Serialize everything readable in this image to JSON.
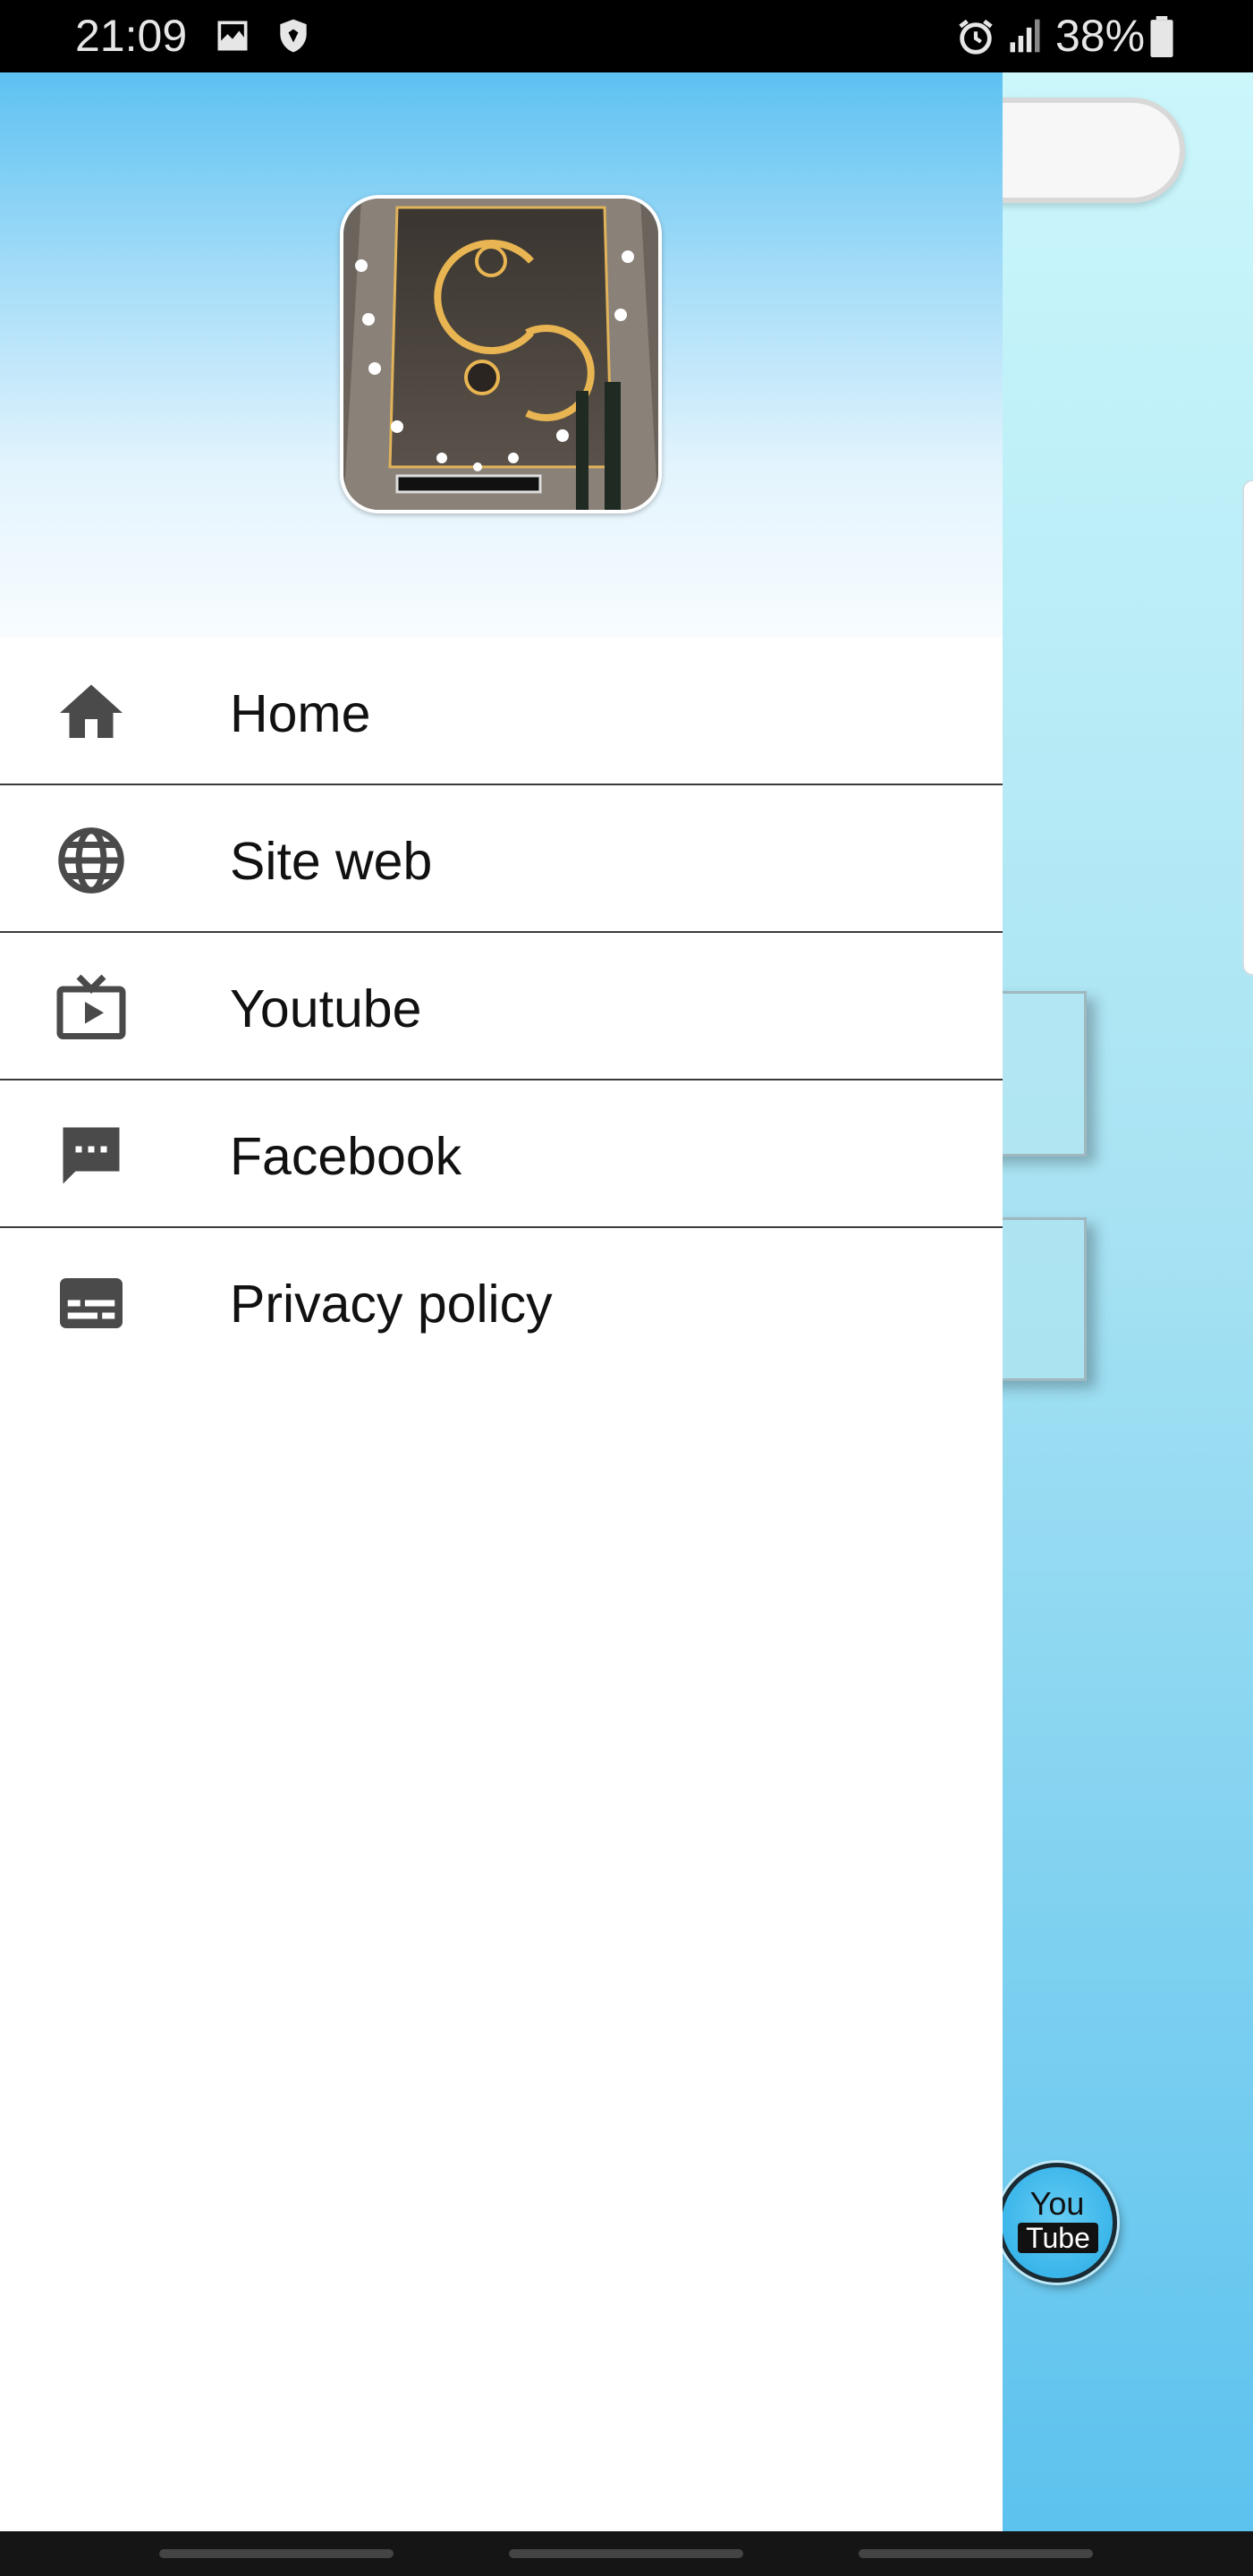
{
  "status_bar": {
    "time": "21:09",
    "battery_text": "38%",
    "icons": [
      "image-icon",
      "shield-icon",
      "alarm-icon",
      "signal-icon",
      "battery-icon"
    ]
  },
  "drawer": {
    "header": {
      "logo": "ceiling-design-image"
    },
    "menu": [
      {
        "label": "Home",
        "icon": "home-icon"
      },
      {
        "label": "Site web",
        "icon": "globe-icon"
      },
      {
        "label": "Youtube",
        "icon": "tv-play-icon"
      },
      {
        "label": "Facebook",
        "icon": "chat-bubble-icon"
      },
      {
        "label": "Privacy policy",
        "icon": "subtitles-icon"
      }
    ]
  },
  "background_app": {
    "youtube_badge": {
      "top": "You",
      "bottom": "Tube"
    }
  },
  "colors": {
    "drawer_header_top": "#5dc1f1",
    "background_top": "#cbf7fb",
    "background_bottom": "#5cc2ee",
    "icon_gray": "#4a4a4a",
    "divider": "#3a3a3a"
  }
}
